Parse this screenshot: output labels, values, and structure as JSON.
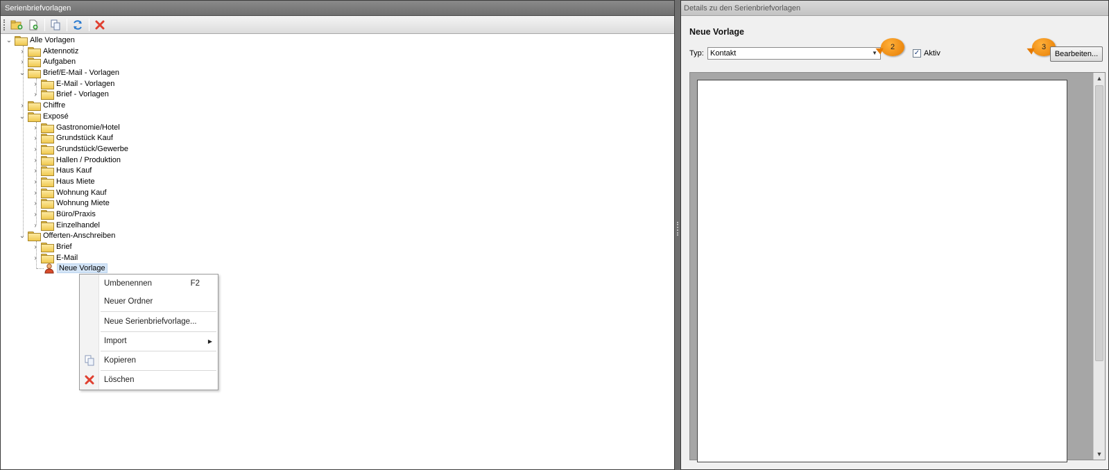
{
  "left_panel": {
    "title": "Serienbriefvorlagen",
    "toolbar": [
      "new-folder-icon",
      "new-document-icon",
      "copy-icon",
      "refresh-icon",
      "delete-icon"
    ]
  },
  "tree": {
    "root": "Alle Vorlagen",
    "items": [
      {
        "label": "Aktennotiz"
      },
      {
        "label": "Aufgaben"
      },
      {
        "label": "Brief/E-Mail - Vorlagen"
      },
      {
        "label": "E-Mail - Vorlagen"
      },
      {
        "label": "Brief - Vorlagen"
      },
      {
        "label": "Chiffre"
      },
      {
        "label": "Exposé"
      },
      {
        "label": "Gastronomie/Hotel"
      },
      {
        "label": "Grundstück Kauf"
      },
      {
        "label": "Grundstück/Gewerbe"
      },
      {
        "label": "Hallen / Produktion"
      },
      {
        "label": "Haus Kauf"
      },
      {
        "label": "Haus Miete"
      },
      {
        "label": "Wohnung Kauf"
      },
      {
        "label": "Wohnung Miete"
      },
      {
        "label": "Büro/Praxis"
      },
      {
        "label": "Einzelhandel"
      },
      {
        "label": "Offerten-Anschreiben"
      },
      {
        "label": "Brief"
      },
      {
        "label": "E-Mail"
      },
      {
        "label": "Neue Vorlage"
      }
    ]
  },
  "context_menu": {
    "rename": "Umbenennen",
    "rename_shortcut": "F2",
    "new_folder": "Neuer Ordner",
    "new_template": "Neue Serienbriefvorlage...",
    "import": "Import",
    "copy": "Kopieren",
    "delete": "Löschen"
  },
  "right_panel": {
    "title": "Details zu den Serienbriefvorlagen",
    "heading": "Neue Vorlage",
    "typ_label": "Typ:",
    "typ_value": "Kontakt",
    "aktiv_label": "Aktiv",
    "aktiv_checked": "✓",
    "edit_button": "Bearbeiten...",
    "badge_2": "2",
    "badge_3": "3"
  },
  "colors": {
    "accent_badge": "#f08a00",
    "selection": "#d4e5f7"
  }
}
